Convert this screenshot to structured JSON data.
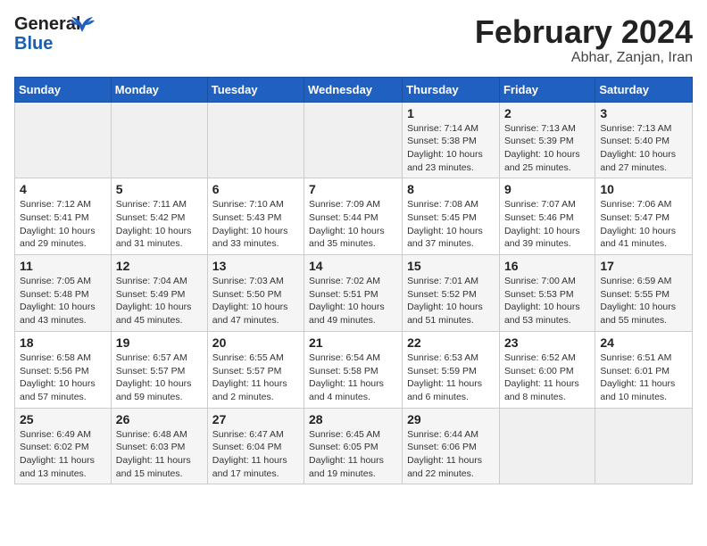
{
  "header": {
    "logo": {
      "general": "General",
      "blue": "Blue",
      "bird_unicode": "🐦"
    },
    "title": "February 2024",
    "location": "Abhar, Zanjan, Iran"
  },
  "weekdays": [
    "Sunday",
    "Monday",
    "Tuesday",
    "Wednesday",
    "Thursday",
    "Friday",
    "Saturday"
  ],
  "weeks": [
    {
      "days": [
        {
          "number": "",
          "info": ""
        },
        {
          "number": "",
          "info": ""
        },
        {
          "number": "",
          "info": ""
        },
        {
          "number": "",
          "info": ""
        },
        {
          "number": "1",
          "info": "Sunrise: 7:14 AM\nSunset: 5:38 PM\nDaylight: 10 hours\nand 23 minutes."
        },
        {
          "number": "2",
          "info": "Sunrise: 7:13 AM\nSunset: 5:39 PM\nDaylight: 10 hours\nand 25 minutes."
        },
        {
          "number": "3",
          "info": "Sunrise: 7:13 AM\nSunset: 5:40 PM\nDaylight: 10 hours\nand 27 minutes."
        }
      ]
    },
    {
      "days": [
        {
          "number": "4",
          "info": "Sunrise: 7:12 AM\nSunset: 5:41 PM\nDaylight: 10 hours\nand 29 minutes."
        },
        {
          "number": "5",
          "info": "Sunrise: 7:11 AM\nSunset: 5:42 PM\nDaylight: 10 hours\nand 31 minutes."
        },
        {
          "number": "6",
          "info": "Sunrise: 7:10 AM\nSunset: 5:43 PM\nDaylight: 10 hours\nand 33 minutes."
        },
        {
          "number": "7",
          "info": "Sunrise: 7:09 AM\nSunset: 5:44 PM\nDaylight: 10 hours\nand 35 minutes."
        },
        {
          "number": "8",
          "info": "Sunrise: 7:08 AM\nSunset: 5:45 PM\nDaylight: 10 hours\nand 37 minutes."
        },
        {
          "number": "9",
          "info": "Sunrise: 7:07 AM\nSunset: 5:46 PM\nDaylight: 10 hours\nand 39 minutes."
        },
        {
          "number": "10",
          "info": "Sunrise: 7:06 AM\nSunset: 5:47 PM\nDaylight: 10 hours\nand 41 minutes."
        }
      ]
    },
    {
      "days": [
        {
          "number": "11",
          "info": "Sunrise: 7:05 AM\nSunset: 5:48 PM\nDaylight: 10 hours\nand 43 minutes."
        },
        {
          "number": "12",
          "info": "Sunrise: 7:04 AM\nSunset: 5:49 PM\nDaylight: 10 hours\nand 45 minutes."
        },
        {
          "number": "13",
          "info": "Sunrise: 7:03 AM\nSunset: 5:50 PM\nDaylight: 10 hours\nand 47 minutes."
        },
        {
          "number": "14",
          "info": "Sunrise: 7:02 AM\nSunset: 5:51 PM\nDaylight: 10 hours\nand 49 minutes."
        },
        {
          "number": "15",
          "info": "Sunrise: 7:01 AM\nSunset: 5:52 PM\nDaylight: 10 hours\nand 51 minutes."
        },
        {
          "number": "16",
          "info": "Sunrise: 7:00 AM\nSunset: 5:53 PM\nDaylight: 10 hours\nand 53 minutes."
        },
        {
          "number": "17",
          "info": "Sunrise: 6:59 AM\nSunset: 5:55 PM\nDaylight: 10 hours\nand 55 minutes."
        }
      ]
    },
    {
      "days": [
        {
          "number": "18",
          "info": "Sunrise: 6:58 AM\nSunset: 5:56 PM\nDaylight: 10 hours\nand 57 minutes."
        },
        {
          "number": "19",
          "info": "Sunrise: 6:57 AM\nSunset: 5:57 PM\nDaylight: 10 hours\nand 59 minutes."
        },
        {
          "number": "20",
          "info": "Sunrise: 6:55 AM\nSunset: 5:57 PM\nDaylight: 11 hours\nand 2 minutes."
        },
        {
          "number": "21",
          "info": "Sunrise: 6:54 AM\nSunset: 5:58 PM\nDaylight: 11 hours\nand 4 minutes."
        },
        {
          "number": "22",
          "info": "Sunrise: 6:53 AM\nSunset: 5:59 PM\nDaylight: 11 hours\nand 6 minutes."
        },
        {
          "number": "23",
          "info": "Sunrise: 6:52 AM\nSunset: 6:00 PM\nDaylight: 11 hours\nand 8 minutes."
        },
        {
          "number": "24",
          "info": "Sunrise: 6:51 AM\nSunset: 6:01 PM\nDaylight: 11 hours\nand 10 minutes."
        }
      ]
    },
    {
      "days": [
        {
          "number": "25",
          "info": "Sunrise: 6:49 AM\nSunset: 6:02 PM\nDaylight: 11 hours\nand 13 minutes."
        },
        {
          "number": "26",
          "info": "Sunrise: 6:48 AM\nSunset: 6:03 PM\nDaylight: 11 hours\nand 15 minutes."
        },
        {
          "number": "27",
          "info": "Sunrise: 6:47 AM\nSunset: 6:04 PM\nDaylight: 11 hours\nand 17 minutes."
        },
        {
          "number": "28",
          "info": "Sunrise: 6:45 AM\nSunset: 6:05 PM\nDaylight: 11 hours\nand 19 minutes."
        },
        {
          "number": "29",
          "info": "Sunrise: 6:44 AM\nSunset: 6:06 PM\nDaylight: 11 hours\nand 22 minutes."
        },
        {
          "number": "",
          "info": ""
        },
        {
          "number": "",
          "info": ""
        }
      ]
    }
  ]
}
